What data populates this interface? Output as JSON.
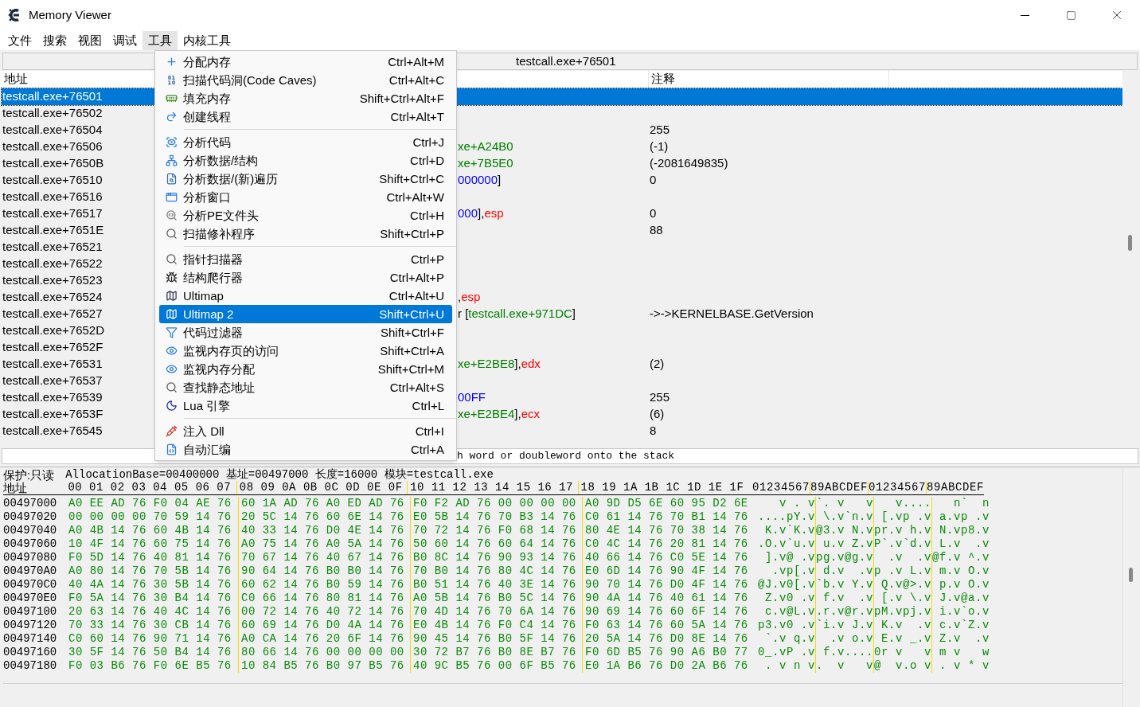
{
  "window": {
    "title": "Memory Viewer"
  },
  "menubar": [
    {
      "label": "文件",
      "selected": false
    },
    {
      "label": "搜索",
      "selected": false
    },
    {
      "label": "视图",
      "selected": false
    },
    {
      "label": "调试",
      "selected": false
    },
    {
      "label": "工具",
      "selected": true
    },
    {
      "label": "内核工具",
      "selected": false
    }
  ],
  "address_bar": "testcall.exe+76501",
  "disassembly": {
    "columns": [
      "地址",
      "注释"
    ],
    "rows": [
      {
        "address": "testcall.exe+76501",
        "selected": true,
        "code": [],
        "comment": ""
      },
      {
        "address": "testcall.exe+76502",
        "selected": false,
        "code": [],
        "comment": ""
      },
      {
        "address": "testcall.exe+76504",
        "selected": false,
        "code": [],
        "comment": "255"
      },
      {
        "address": "testcall.exe+76506",
        "selected": false,
        "code": [
          {
            "kind": "address",
            "text": "xe+A24B0"
          }
        ],
        "comment": "(-1)"
      },
      {
        "address": "testcall.exe+7650B",
        "selected": false,
        "code": [
          {
            "kind": "address",
            "text": "xe+7B5E0"
          }
        ],
        "comment": "(-2081649835)"
      },
      {
        "address": "testcall.exe+76510",
        "selected": false,
        "code": [
          {
            "kind": "number",
            "text": "000000"
          },
          {
            "kind": "plain",
            "text": "]"
          }
        ],
        "comment": "0"
      },
      {
        "address": "testcall.exe+76516",
        "selected": false,
        "code": [],
        "comment": ""
      },
      {
        "address": "testcall.exe+76517",
        "selected": false,
        "code": [
          {
            "kind": "number",
            "text": "000"
          },
          {
            "kind": "plain",
            "text": "],"
          },
          {
            "kind": "register",
            "text": "esp"
          }
        ],
        "comment": "0"
      },
      {
        "address": "testcall.exe+7651E",
        "selected": false,
        "code": [],
        "comment": "88"
      },
      {
        "address": "testcall.exe+76521",
        "selected": false,
        "code": [],
        "comment": ""
      },
      {
        "address": "testcall.exe+76522",
        "selected": false,
        "code": [],
        "comment": ""
      },
      {
        "address": "testcall.exe+76523",
        "selected": false,
        "code": [],
        "comment": ""
      },
      {
        "address": "testcall.exe+76524",
        "selected": false,
        "code": [
          {
            "kind": "plain",
            "text": ","
          },
          {
            "kind": "register",
            "text": "esp"
          }
        ],
        "comment": ""
      },
      {
        "address": "testcall.exe+76527",
        "selected": false,
        "code": [
          {
            "kind": "plain",
            "text": "r ["
          },
          {
            "kind": "address",
            "text": "testcall.exe+971DC"
          },
          {
            "kind": "plain",
            "text": "]"
          }
        ],
        "comment": "->->KERNELBASE.GetVersion"
      },
      {
        "address": "testcall.exe+7652D",
        "selected": false,
        "code": [],
        "comment": ""
      },
      {
        "address": "testcall.exe+7652F",
        "selected": false,
        "code": [],
        "comment": ""
      },
      {
        "address": "testcall.exe+76531",
        "selected": false,
        "code": [
          {
            "kind": "address",
            "text": "xe+E2BE8"
          },
          {
            "kind": "plain",
            "text": "],"
          },
          {
            "kind": "register",
            "text": "edx"
          }
        ],
        "comment": "(2)"
      },
      {
        "address": "testcall.exe+76537",
        "selected": false,
        "code": [],
        "comment": ""
      },
      {
        "address": "testcall.exe+76539",
        "selected": false,
        "code": [
          {
            "kind": "number",
            "text": "00FF"
          }
        ],
        "comment": "255"
      },
      {
        "address": "testcall.exe+7653F",
        "selected": false,
        "code": [
          {
            "kind": "address",
            "text": "xe+E2BE4"
          },
          {
            "kind": "plain",
            "text": "],"
          },
          {
            "kind": "register",
            "text": "ecx"
          }
        ],
        "comment": "(6)"
      },
      {
        "address": "testcall.exe+76545",
        "selected": false,
        "code": [],
        "comment": "8"
      }
    ]
  },
  "description": "h word or doubleword onto the stack",
  "tools_menu": [
    [
      {
        "label": "分配内存",
        "shortcut": "Ctrl+Alt+M",
        "selected": false
      },
      {
        "label": "扫描代码洞(Code Caves)",
        "shortcut": "Ctrl+Alt+C",
        "selected": false
      },
      {
        "label": "填充内存",
        "shortcut": "Shift+Ctrl+Alt+F",
        "selected": false
      },
      {
        "label": "创建线程",
        "shortcut": "Ctrl+Alt+T",
        "selected": false
      }
    ],
    [
      {
        "label": "分析代码",
        "shortcut": "Ctrl+J",
        "selected": false
      },
      {
        "label": "分析数据/结构",
        "shortcut": "Ctrl+D",
        "selected": false
      },
      {
        "label": "分析数据/(新)遍历",
        "shortcut": "Shift+Ctrl+C",
        "selected": false
      },
      {
        "label": "分析窗口",
        "shortcut": "Ctrl+Alt+W",
        "selected": false
      },
      {
        "label": "分析PE文件头",
        "shortcut": "Ctrl+H",
        "selected": false
      },
      {
        "label": "扫描修补程序",
        "shortcut": "Shift+Ctrl+P",
        "selected": false
      }
    ],
    [
      {
        "label": "指针扫描器",
        "shortcut": "Ctrl+P",
        "selected": false
      },
      {
        "label": "结构爬行器",
        "shortcut": "Ctrl+Alt+P",
        "selected": false
      },
      {
        "label": "Ultimap",
        "shortcut": "Ctrl+Alt+U",
        "selected": false
      },
      {
        "label": "Ultimap 2",
        "shortcut": "Shift+Ctrl+U",
        "selected": true
      },
      {
        "label": "代码过滤器",
        "shortcut": "Shift+Ctrl+F",
        "selected": false
      },
      {
        "label": "监视内存页的访问",
        "shortcut": "Shift+Ctrl+A",
        "selected": false
      },
      {
        "label": "监视内存分配",
        "shortcut": "Shift+Ctrl+M",
        "selected": false
      },
      {
        "label": "查找静态地址",
        "shortcut": "Ctrl+Alt+S",
        "selected": false
      },
      {
        "label": "Lua 引擎",
        "shortcut": "Ctrl+L",
        "selected": false
      }
    ],
    [
      {
        "label": "注入 Dll",
        "shortcut": "Ctrl+I",
        "selected": false
      },
      {
        "label": "自动汇编",
        "shortcut": "Ctrl+A",
        "selected": false
      }
    ]
  ],
  "hex": {
    "protection": "保护:只读",
    "info": "AllocationBase=00400000 基址=00497000 长度=16000 模块=testcall.exe",
    "address_header": "地址",
    "byte_header": [
      "00 01 02 03 04 05 06 07",
      "08 09 0A 0B 0C 0D 0E 0F",
      "10 11 12 13 14 15 16 17",
      "18 19 1A 1B 1C 1D 1E 1F"
    ],
    "ascii_header": [
      "01234567",
      "89ABCDEF",
      "01234567",
      "89ABCDEF"
    ],
    "rows": [
      {
        "address": "00497000",
        "bytes": [
          "A0 EE AD 76 F0 04 AE 76",
          "60 1A AD 76 A0 ED AD 76",
          "F0 F2 AD 76 00 00 00 00",
          "A0 9D D5 6E 60 95 D2 6E"
        ],
        "ascii": [
          "   v . v",
          "`. v   v",
          "   v....",
          "   n`  n"
        ]
      },
      {
        "address": "00497020",
        "bytes": [
          "00 00 00 00 70 59 14 76",
          "20 5C 14 76 60 6E 14 76",
          "E0 5B 14 76 70 B3 14 76",
          "C0 61 14 76 70 B1 14 76"
        ],
        "ascii": [
          "....pY.v",
          " \\.v`n.v",
          " [.vp .v",
          " a.vp .v"
        ]
      },
      {
        "address": "00497040",
        "bytes": [
          "A0 4B 14 76 60 4B 14 76",
          "40 33 14 76 D0 4E 14 76",
          "70 72 14 76 F0 68 14 76",
          "80 4E 14 76 70 38 14 76"
        ],
        "ascii": [
          " K.v`K.v",
          "@3.v N.v",
          "pr.v h.v",
          " N.vp8.v"
        ]
      },
      {
        "address": "00497060",
        "bytes": [
          "10 4F 14 76 60 75 14 76",
          "A0 75 14 76 A0 5A 14 76",
          "50 60 14 76 60 64 14 76",
          "C0 4C 14 76 20 81 14 76"
        ],
        "ascii": [
          ".O.v`u.v",
          " u.v Z.v",
          "P`.v`d.v",
          " L.v  .v"
        ]
      },
      {
        "address": "00497080",
        "bytes": [
          "F0 5D 14 76 40 81 14 76",
          "70 67 14 76 40 67 14 76",
          "B0 8C 14 76 90 93 14 76",
          "40 66 14 76 C0 5E 14 76"
        ],
        "ascii": [
          " ].v@ .v",
          "pg.v@g.v",
          "  .v  .v",
          "@f.v ^.v"
        ]
      },
      {
        "address": "004970A0",
        "bytes": [
          "A0 80 14 76 70 5B 14 76",
          "90 64 14 76 B0 B0 14 76",
          "70 B0 14 76 80 4C 14 76",
          "E0 6D 14 76 90 4F 14 76"
        ],
        "ascii": [
          "  .vp[.v",
          " d.v  .v",
          "p .v L.v",
          " m.v O.v"
        ]
      },
      {
        "address": "004970C0",
        "bytes": [
          "40 4A 14 76 30 5B 14 76",
          "60 62 14 76 B0 59 14 76",
          "B0 51 14 76 40 3E 14 76",
          "90 70 14 76 D0 4F 14 76"
        ],
        "ascii": [
          "@J.v0[.v",
          "`b.v Y.v",
          " Q.v@>.v",
          " p.v O.v"
        ]
      },
      {
        "address": "004970E0",
        "bytes": [
          "F0 5A 14 76 30 B4 14 76",
          "C0 66 14 76 80 81 14 76",
          "A0 5B 14 76 B0 5C 14 76",
          "90 4A 14 76 40 61 14 76"
        ],
        "ascii": [
          " Z.v0 .v",
          " f.v  .v",
          " [.v \\.v",
          " J.v@a.v"
        ]
      },
      {
        "address": "00497100",
        "bytes": [
          "20 63 14 76 40 4C 14 76",
          "00 72 14 76 40 72 14 76",
          "70 4D 14 76 70 6A 14 76",
          "90 69 14 76 60 6F 14 76"
        ],
        "ascii": [
          " c.v@L.v",
          ".r.v@r.v",
          "pM.vpj.v",
          " i.v`o.v"
        ]
      },
      {
        "address": "00497120",
        "bytes": [
          "70 33 14 76 30 CB 14 76",
          "60 69 14 76 D0 4A 14 76",
          "E0 4B 14 76 F0 C4 14 76",
          "F0 63 14 76 60 5A 14 76"
        ],
        "ascii": [
          "p3.v0 .v",
          "`i.v J.v",
          " K.v  .v",
          " c.v`Z.v"
        ]
      },
      {
        "address": "00497140",
        "bytes": [
          "C0 60 14 76 90 71 14 76",
          "A0 CA 14 76 20 6F 14 76",
          "90 45 14 76 B0 5F 14 76",
          "20 5A 14 76 D0 8E 14 76"
        ],
        "ascii": [
          " `.v q.v",
          "  .v o.v",
          " E.v _.v",
          " Z.v  .v"
        ]
      },
      {
        "address": "00497160",
        "bytes": [
          "30 5F 14 76 50 B4 14 76",
          "80 66 14 76 00 00 00 00",
          "30 72 B7 76 B0 8E B7 76",
          "F0 6D B5 76 90 A6 B0 77"
        ],
        "ascii": [
          "0_.vP .v",
          " f.v....",
          "0r v   v",
          " m v   w"
        ]
      },
      {
        "address": "00497180",
        "bytes": [
          "F0 03 B6 76 F0 6E B5 76",
          "10 84 B5 76 B0 97 B5 76",
          "40 9C B5 76 00 6F B5 76",
          "E0 1A B6 76 D0 2A B6 76"
        ],
        "ascii": [
          " . v n v",
          ".  v   v",
          "@  v.o v",
          " . v * v"
        ]
      }
    ]
  }
}
